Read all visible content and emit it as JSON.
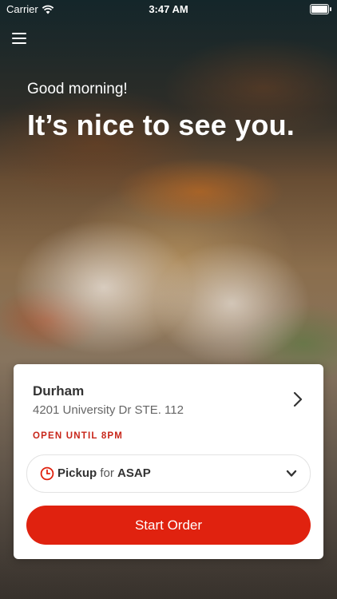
{
  "status_bar": {
    "carrier": "Carrier",
    "time": "3:47 AM"
  },
  "header": {
    "greeting": "Good morning!",
    "headline": "It’s nice to see you."
  },
  "location": {
    "name": "Durham",
    "address": "4201 University Dr STE. 112",
    "status": "OPEN UNTIL 8PM"
  },
  "order_mode": {
    "mode": "Pickup",
    "connector": "for",
    "time": "ASAP"
  },
  "actions": {
    "start_label": "Start Order"
  },
  "colors": {
    "accent": "#e0220f",
    "status_text": "#c8261a"
  },
  "icons": [
    "wifi-icon",
    "battery-icon",
    "menu-icon",
    "chevron-right-icon",
    "clock-icon",
    "chevron-down-icon"
  ]
}
